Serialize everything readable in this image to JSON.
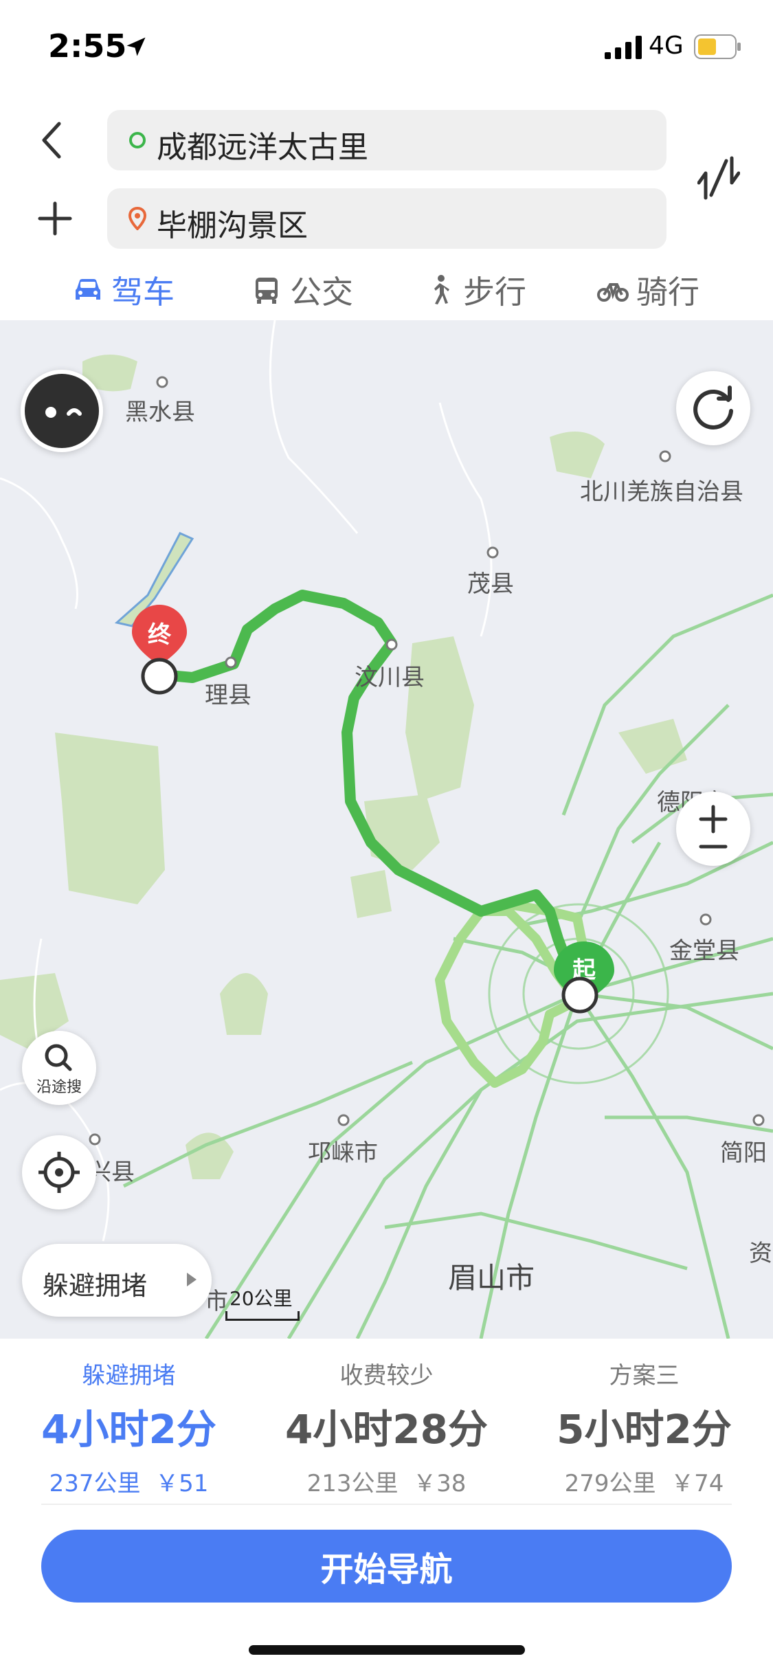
{
  "status_bar": {
    "time": "2:55",
    "network": "4G"
  },
  "route": {
    "origin": "成都远洋太古里",
    "destination": "毕棚沟景区"
  },
  "modes": [
    {
      "label": "驾车",
      "icon": "car-icon",
      "active": true
    },
    {
      "label": "公交",
      "icon": "bus-icon",
      "active": false
    },
    {
      "label": "步行",
      "icon": "walk-icon",
      "active": false
    },
    {
      "label": "骑行",
      "icon": "bike-icon",
      "active": false
    }
  ],
  "map": {
    "places": {
      "heishui": "黑水县",
      "beichuan": "北川羌族自治县",
      "maoxian": "茂县",
      "lixian": "理县",
      "wenchuan": "汶川县",
      "deyang": "德阳市",
      "jintang": "金堂县",
      "qionglai": "邛崃市",
      "jianyang": "简阳",
      "meishan": "眉山市",
      "zi": "资",
      "xing": "兴县",
      "shi": "市"
    },
    "end_marker": "终",
    "start_marker": "起",
    "search_along_label": "沿途搜",
    "avoid_congestion_label": "躲避拥堵",
    "scale_label": "20公里",
    "colors": {
      "route_main": "#4cb94e",
      "route_alt": "#a6dc8c",
      "end_pin": "#e84747",
      "start_pin": "#3bb54a",
      "road": "#9bd69a"
    }
  },
  "options": [
    {
      "tag": "躲避拥堵",
      "duration": "4小时2分",
      "distance": "237公里",
      "toll": "￥51",
      "active": true
    },
    {
      "tag": "收费较少",
      "duration": "4小时28分",
      "distance": "213公里",
      "toll": "￥38",
      "active": false
    },
    {
      "tag": "方案三",
      "duration": "5小时2分",
      "distance": "279公里",
      "toll": "￥74",
      "active": false
    }
  ],
  "start_nav_label": "开始导航",
  "accent_color": "#4a7cf3"
}
